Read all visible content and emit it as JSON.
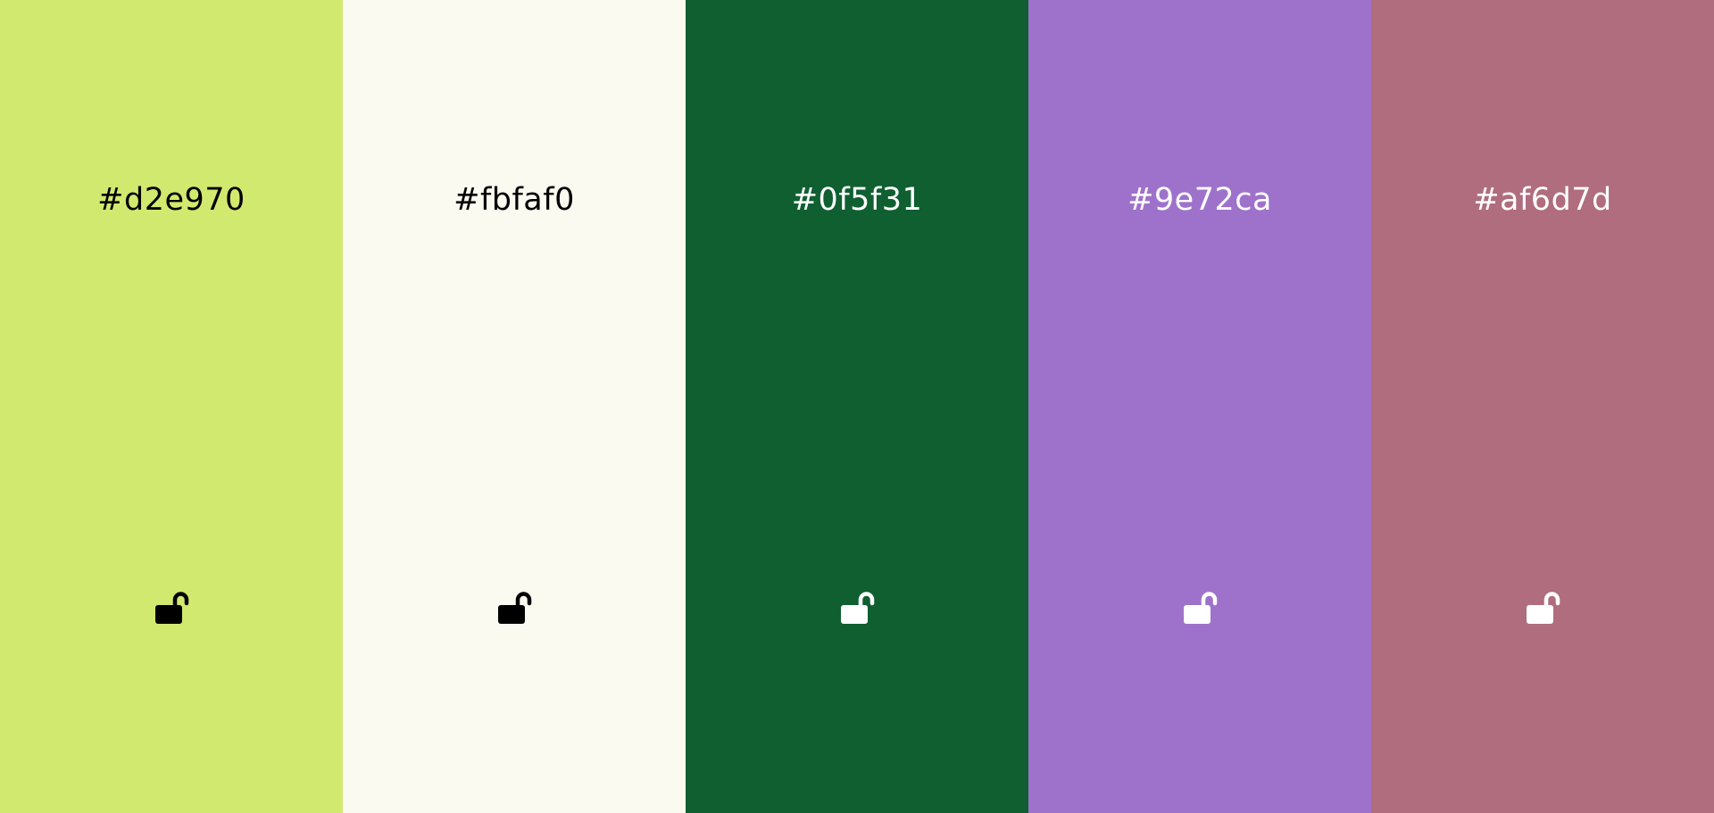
{
  "palette": {
    "swatches": [
      {
        "hex": "#d2e970",
        "color": "#d2e970",
        "text_color": "#000000",
        "lock_icon": "unlocked-padlock-icon",
        "locked": false
      },
      {
        "hex": "#fbfaf0",
        "color": "#fbfaf0",
        "text_color": "#000000",
        "lock_icon": "unlocked-padlock-icon",
        "locked": false
      },
      {
        "hex": "#0f5f31",
        "color": "#0f5f31",
        "text_color": "#ffffff",
        "lock_icon": "unlocked-padlock-icon",
        "locked": false
      },
      {
        "hex": "#9e72ca",
        "color": "#9e72ca",
        "text_color": "#ffffff",
        "lock_icon": "unlocked-padlock-icon",
        "locked": false
      },
      {
        "hex": "#af6d7d",
        "color": "#af6d7d",
        "text_color": "#ffffff",
        "lock_icon": "unlocked-padlock-icon",
        "locked": false
      }
    ]
  }
}
